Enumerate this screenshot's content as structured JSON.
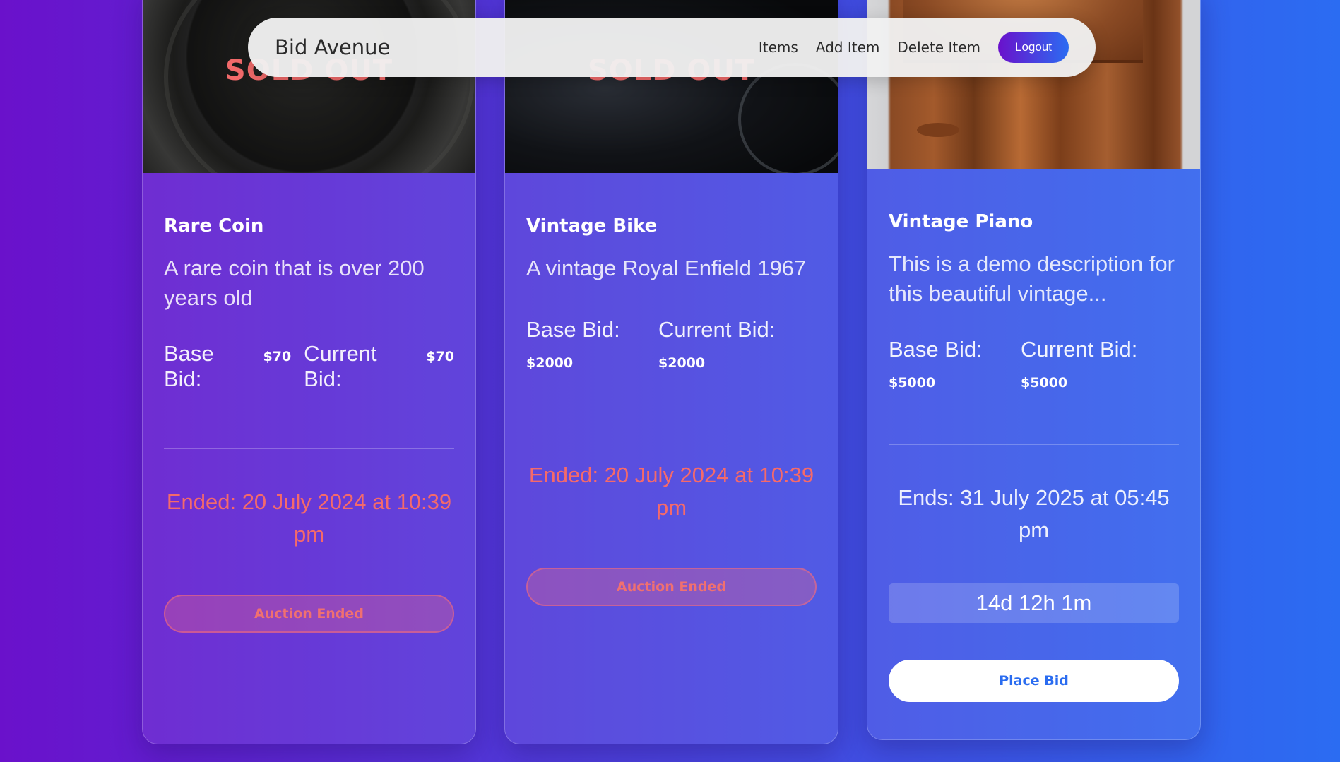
{
  "navbar": {
    "brand": "Bid Avenue",
    "links": [
      "Items",
      "Add Item",
      "Delete Item"
    ],
    "logout_label": "Logout"
  },
  "colors": {
    "background_start": "#6a11cb",
    "background_end": "#2b6cf2",
    "sold_out": "#f26a6a",
    "ended_text": "#f56a6a",
    "place_bid_text": "#2a6cf0"
  },
  "items": [
    {
      "overlay": "SOLD OUT",
      "title": "Rare Coin",
      "description": "A rare coin that is over 200 years old",
      "base_bid_label": "Base Bid:",
      "base_bid": "$70",
      "current_bid_label": "Current Bid:",
      "current_bid": "$70",
      "status_text": "Ended: 20 July 2024 at 10:39 pm",
      "button_label": "Auction Ended"
    },
    {
      "overlay": "SOLD OUT",
      "title": "Vintage Bike",
      "description": "A vintage Royal Enfield 1967",
      "base_bid_label": "Base Bid:",
      "base_bid": "$2000",
      "current_bid_label": "Current Bid:",
      "current_bid": "$2000",
      "status_text": "Ended: 20 July 2024 at 10:39 pm",
      "button_label": "Auction Ended"
    },
    {
      "title": "Vintage Piano",
      "description": "This is a demo description for this beautiful vintage...",
      "base_bid_label": "Base Bid:",
      "base_bid": "$5000",
      "current_bid_label": "Current Bid:",
      "current_bid": "$5000",
      "status_text": "Ends: 31 July 2025 at 05:45 pm",
      "countdown": "14d 12h 1m",
      "button_label": "Place Bid"
    }
  ]
}
